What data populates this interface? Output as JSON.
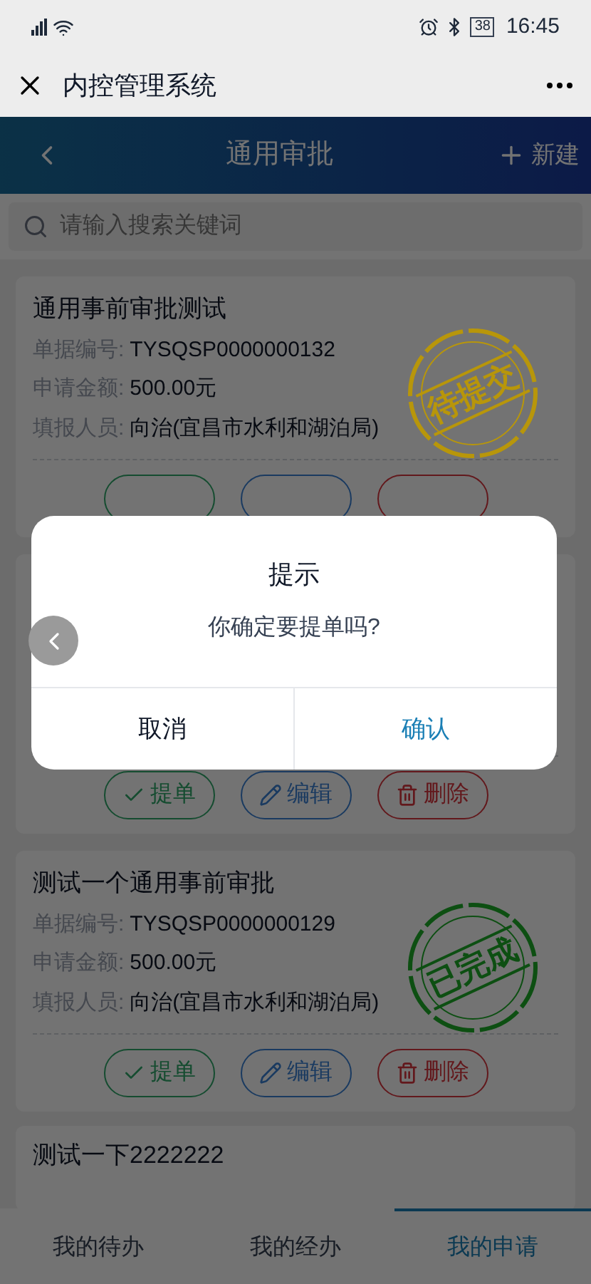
{
  "status_bar": {
    "time": "16:45",
    "battery": "38"
  },
  "app_bar": {
    "title": "内控管理系统"
  },
  "header": {
    "title": "通用审批",
    "action": "新建"
  },
  "search": {
    "placeholder": "请输入搜索关键词"
  },
  "cards": [
    {
      "kind": "full",
      "title": "通用事前审批测试",
      "fields": [
        {
          "label": "单据编号:",
          "value": "TYSQSP0000000132"
        },
        {
          "label": "申请金额:",
          "value": "500.00元"
        },
        {
          "label": "填报人员:",
          "value": "向治(宜昌市水利和湖泊局)"
        }
      ],
      "stamp": {
        "text": "待提交",
        "color": "#b8960a"
      }
    },
    {
      "kind": "covered",
      "actions": [
        "提单",
        "编辑",
        "删除"
      ]
    },
    {
      "kind": "full",
      "title": "测试一个通用事前审批",
      "fields": [
        {
          "label": "单据编号:",
          "value": "TYSQSP0000000129"
        },
        {
          "label": "申请金额:",
          "value": "500.00元"
        },
        {
          "label": "填报人员:",
          "value": "向治(宜昌市水利和湖泊局)"
        }
      ],
      "stamp": {
        "text": "已完成",
        "color": "#0d4f12"
      },
      "actions": [
        "提单",
        "编辑",
        "删除"
      ]
    },
    {
      "kind": "cut",
      "title": "测试一下2222222"
    }
  ],
  "tabs": [
    {
      "label": "我的待办",
      "selected": false
    },
    {
      "label": "我的经办",
      "selected": false
    },
    {
      "label": "我的申请",
      "selected": true
    }
  ],
  "dialog": {
    "title": "提示",
    "message": "你确定要提单吗?",
    "buttons": [
      "取消",
      "确认"
    ]
  }
}
